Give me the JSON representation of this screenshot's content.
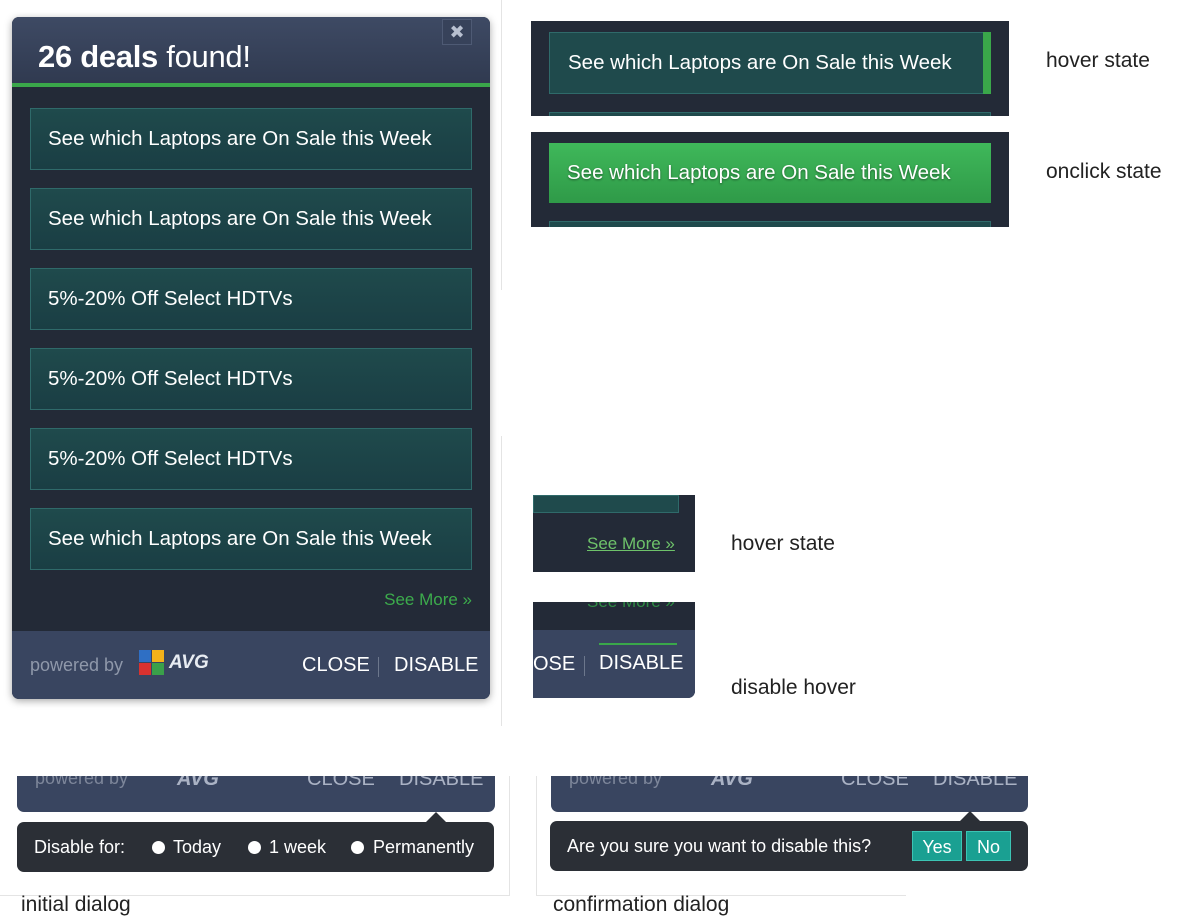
{
  "panel": {
    "title_count": "26 deals",
    "title_rest": " found!",
    "close_icon": "close-x-icon",
    "deals": [
      "See which Laptops are On Sale this Week",
      "See which Laptops are On Sale this Week",
      "5%-20% Off Select HDTVs",
      "5%-20% Off Select HDTVs",
      "5%-20% Off Select HDTVs",
      "See which Laptops are On Sale this Week"
    ],
    "see_more": "See More »",
    "powered_by": "powered by",
    "brand": "AVG",
    "close": "CLOSE",
    "disable": "DISABLE"
  },
  "states": {
    "hover_state": {
      "button": "See which Laptops are On Sale this Week",
      "label": "hover state"
    },
    "onclick_state": {
      "button": "See which Laptops are On Sale this Week",
      "label": "onclick state"
    },
    "see_more_hover": {
      "link": "See More »",
      "label": "hover state"
    },
    "disable_hover": {
      "close_fragment": "OSE",
      "disable": "DISABLE",
      "label": "disable hover"
    }
  },
  "initial_dialog": {
    "ghost_footer": {
      "powered_by": "powered by",
      "brand": "AVG",
      "close": "CLOSE",
      "disable": "DISABLE"
    },
    "prompt": "Disable for:",
    "options": [
      "Today",
      "1 week",
      "Permanently"
    ],
    "caption": "initial dialog"
  },
  "confirmation_dialog": {
    "ghost_footer": {
      "powered_by": "powered by",
      "brand": "AVG",
      "close": "CLOSE",
      "disable": "DISABLE"
    },
    "prompt": "Are you sure you want to disable this?",
    "yes": "Yes",
    "no": "No",
    "caption": "confirmation dialog"
  },
  "colors": {
    "panel_bg": "#232a37",
    "header_bg": "#3a4660",
    "accent_green": "#3aa74a",
    "deal_bg": "#1f4a4c",
    "footer_bg": "#394560",
    "dialog_bg": "#2b2f36",
    "teal_button": "#1aa092"
  }
}
